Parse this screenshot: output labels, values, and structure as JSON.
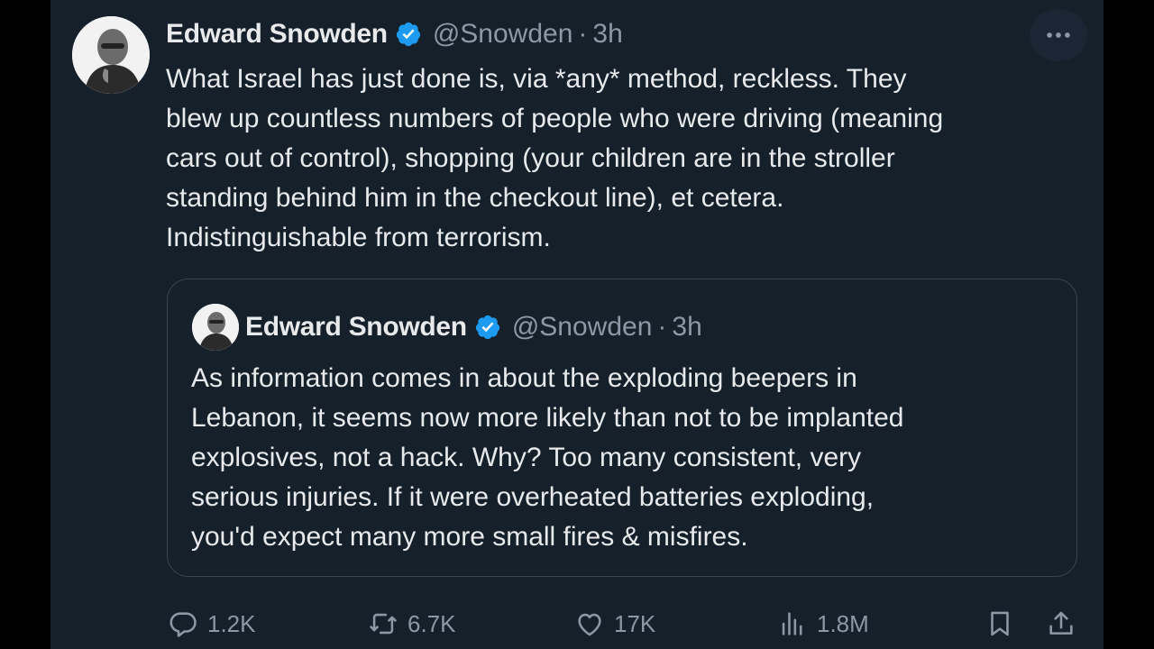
{
  "colors": {
    "background": "#15202b",
    "text": "#e7e9ea",
    "muted": "#8b98a5",
    "verified": "#1d9bf0",
    "border": "#38444d"
  },
  "post": {
    "author_name": "Edward Snowden",
    "handle": "@Snowden",
    "separator": "·",
    "time": "3h",
    "more_icon": "more-horizontal-icon",
    "text_lines": [
      "What Israel has just done is, via *any* method, reckless. They",
      "blew up countless numbers of people who were driving (meaning",
      "cars out of control), shopping (your children are in the stroller",
      "standing behind him in the checkout line), et cetera.",
      "Indistinguishable from terrorism."
    ]
  },
  "quote": {
    "author_name": "Edward Snowden",
    "handle": "@Snowden",
    "separator": "·",
    "time": "3h",
    "text_lines": [
      "As information comes in about the exploding beepers in",
      "Lebanon, it seems now more likely than not to be implanted",
      "explosives, not a hack. Why? Too many consistent, very",
      "serious injuries. If it were overheated batteries exploding,",
      "you'd expect many more small fires & misfires."
    ]
  },
  "actions": {
    "replies": "1.2K",
    "reposts": "6.7K",
    "likes": "17K",
    "views": "1.8M"
  }
}
